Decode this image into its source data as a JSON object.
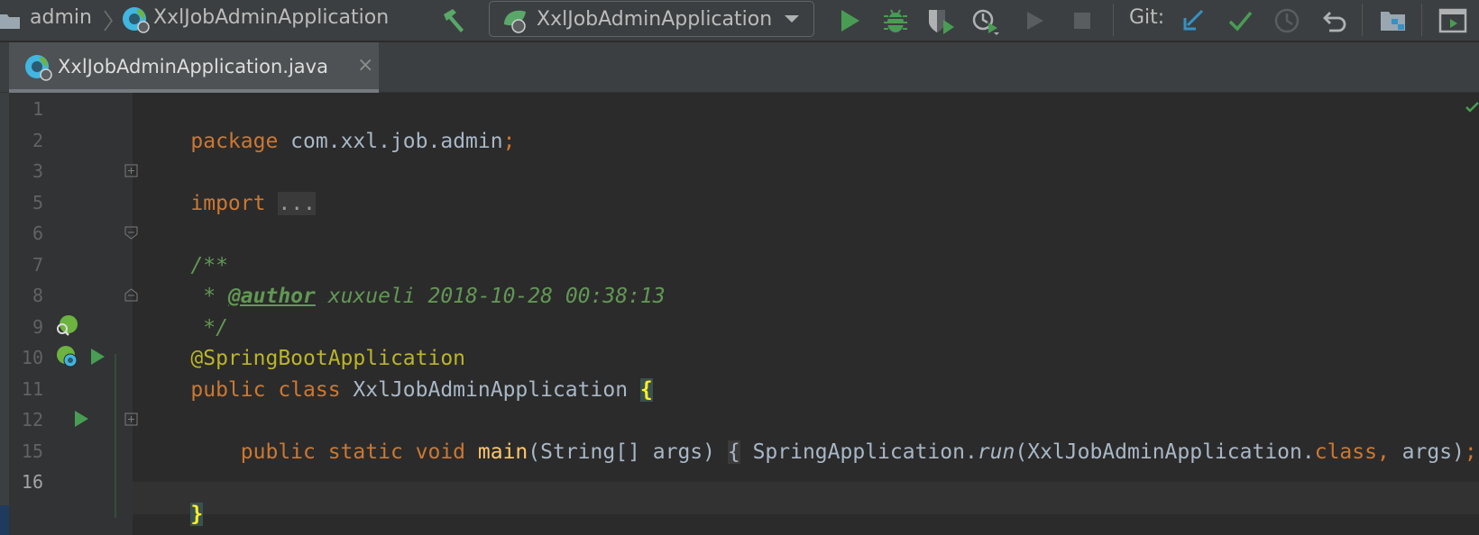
{
  "toolbar": {
    "breadcrumb": [
      "admin",
      "XxlJobAdminApplication"
    ],
    "run_config": "XxlJobAdminApplication",
    "git_label": "Git:",
    "icons": [
      "build-hammer-icon",
      "run-icon",
      "debug-icon",
      "coverage-icon",
      "profile-icon",
      "run-disabled-icon",
      "stop-icon",
      "git-update-icon",
      "git-commit-icon",
      "git-history-icon",
      "git-rollback-icon",
      "project-structure-icon",
      "presentation-icon"
    ]
  },
  "tab": {
    "label": "XxlJobAdminApplication.java",
    "close": "×"
  },
  "line_numbers": [
    "1",
    "2",
    "3",
    "5",
    "6",
    "7",
    "8",
    "9",
    "10",
    "11",
    "12",
    "15",
    "16"
  ],
  "code": {
    "l1_kw": "package",
    "l1_rest": " com.xxl.job.admin",
    "l1_semi": ";",
    "l3_kw": "import",
    "l3_fold": "...",
    "l6": "/**",
    "l7_star": " * ",
    "l7_tag": "@author",
    "l7_rest": " xuxueli 2018-10-28 00:38:13",
    "l8": " */",
    "l9": "@SpringBootApplication",
    "l10_kw": "public class",
    "l10_name": " XxlJobAdminApplication ",
    "l10_brace": "{",
    "l12_indent": "    ",
    "l12_kw": "public static void",
    "l12_sp": " ",
    "l12_fn": "main",
    "l12_params": "(String[] args)",
    "l12_sp2": " ",
    "l12_open": "{",
    "l12_body1": " SpringApplication.",
    "l12_run": "run",
    "l12_body2": "(XxlJobAdminApplication.",
    "l12_cls": "class",
    "l12_comma": ",",
    "l12_args": " args)",
    "l12_semi": ";",
    "l12_sp3": " ",
    "l12_close": "}",
    "l16": "}"
  },
  "colors": {
    "keyword": "#cc7832",
    "annotation": "#bbb529",
    "comment": "#629755",
    "function": "#ffc66d",
    "text": "#a9b7c6"
  }
}
